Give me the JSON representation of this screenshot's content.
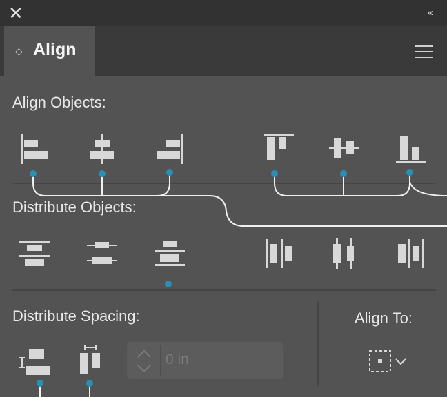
{
  "window": {
    "close_glyph": "✕",
    "collapse_glyph": "‹‹"
  },
  "tab": {
    "label": "Align",
    "arrows_glyph": "◇"
  },
  "sections": {
    "align_objects": "Align Objects:",
    "distribute_objects": "Distribute Objects:",
    "distribute_spacing": "Distribute Spacing:",
    "align_to": "Align To:"
  },
  "spacing": {
    "value": "0 in"
  },
  "colors": {
    "panel": "#535353",
    "titlebar": "#323232",
    "tabbar": "#3a3a3a",
    "icon": "#d8d8d8",
    "marker": "#2a8fb5",
    "callout_line": "#f0f0f0"
  }
}
